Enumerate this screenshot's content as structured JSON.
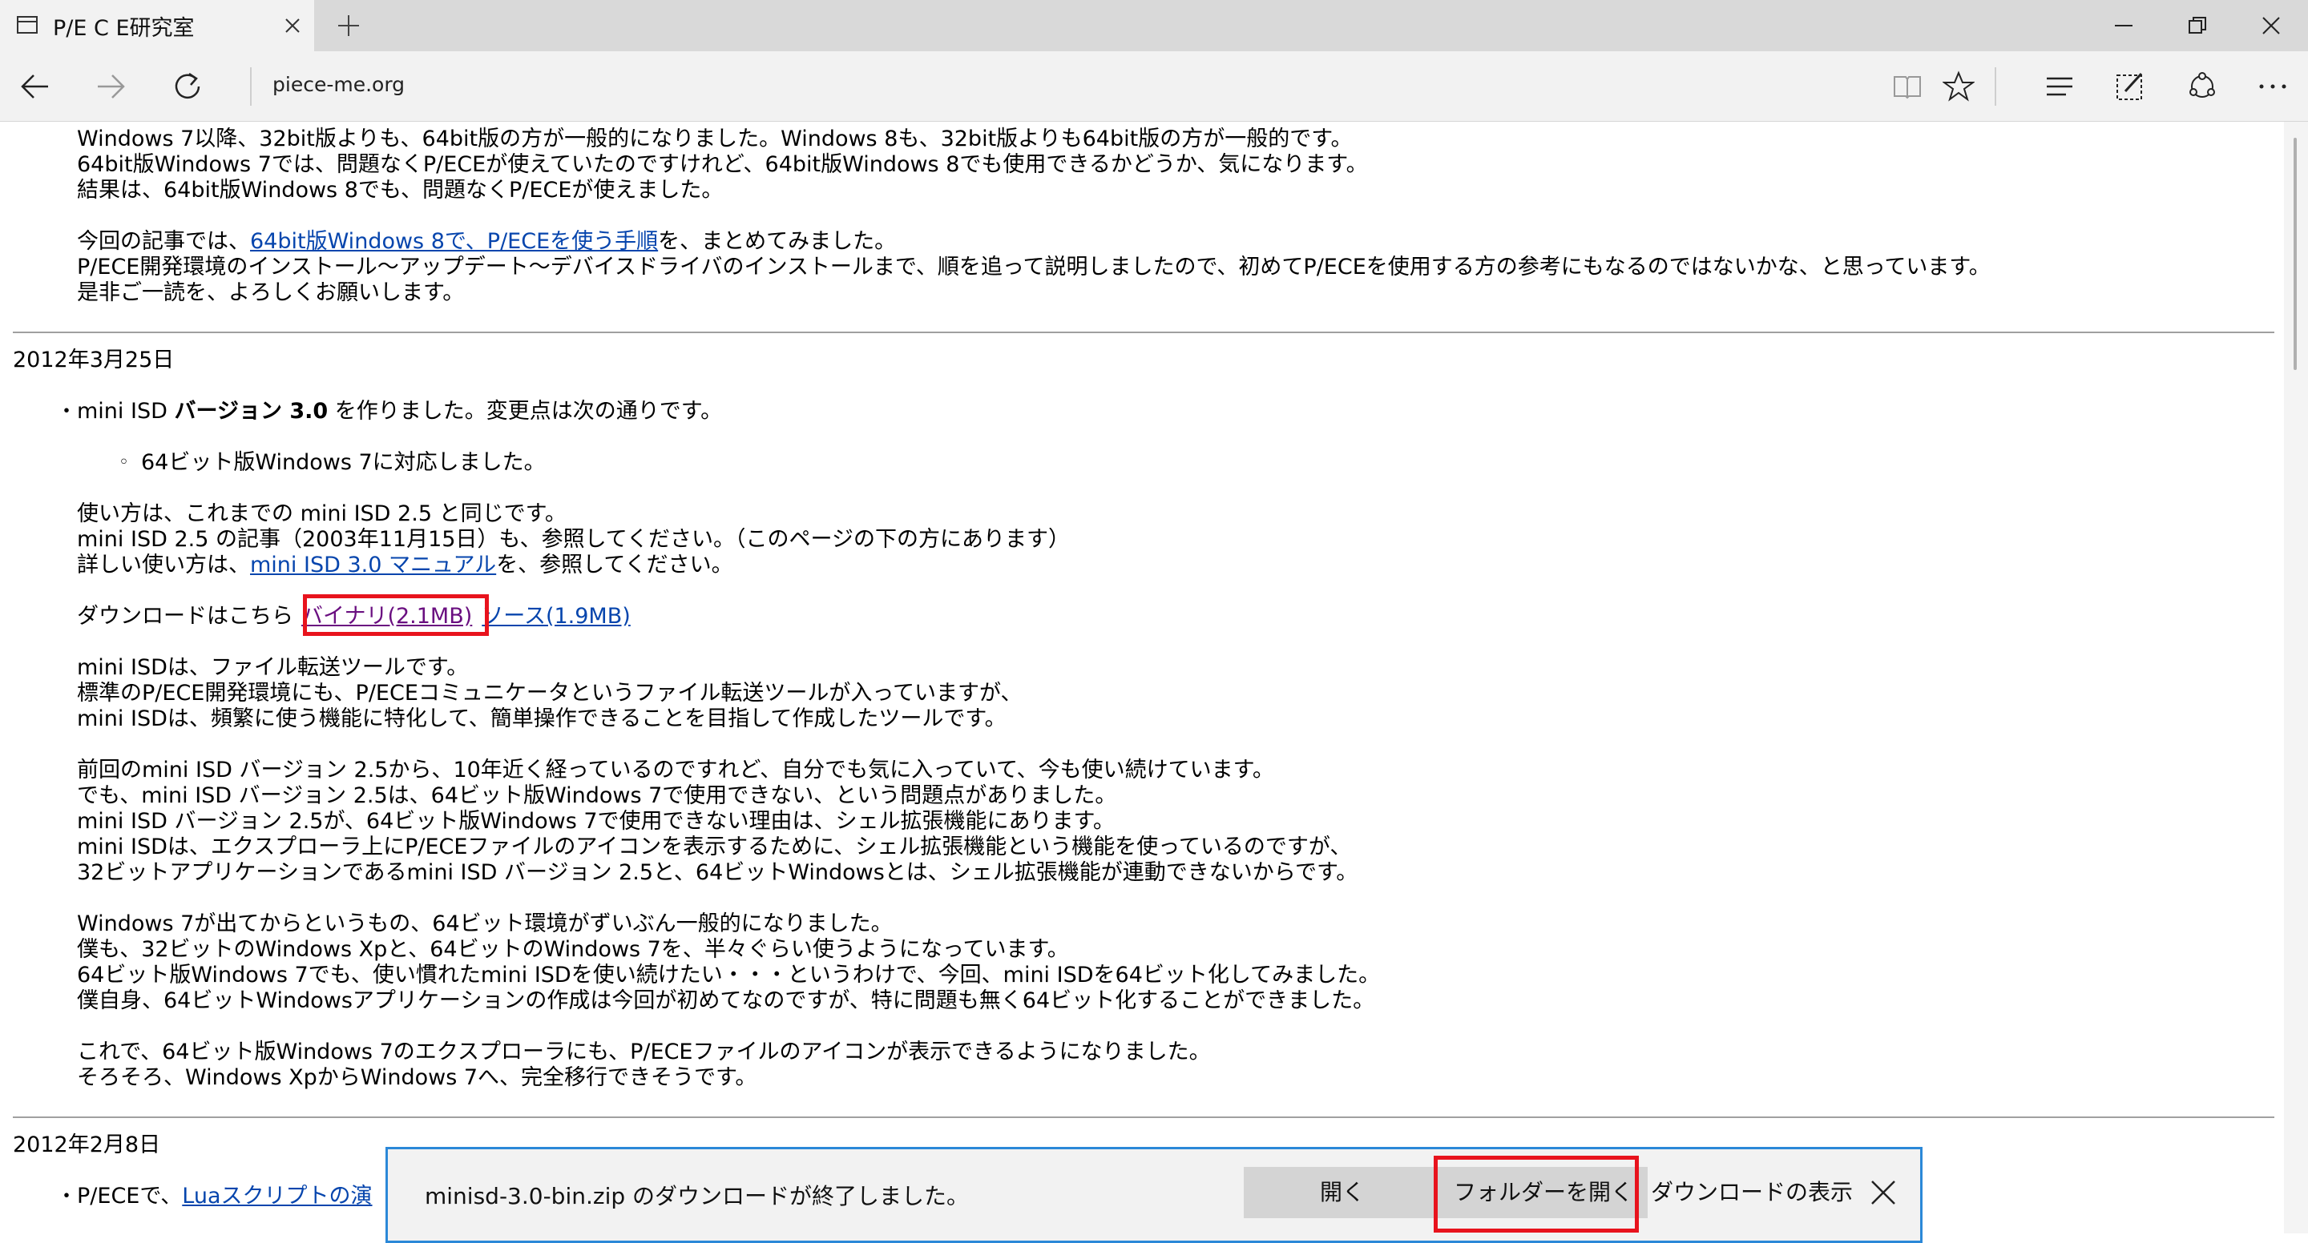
{
  "browser": {
    "tab_title": "P/E C E研究室",
    "new_tab_symbol": "+",
    "address": "piece-me.org",
    "icons": [
      "page-icon",
      "close-icon",
      "plus-icon",
      "minimize-icon",
      "restore-icon",
      "window-close-icon",
      "back-arrow-icon",
      "forward-arrow-icon",
      "refresh-icon",
      "reading-view-icon",
      "favorite-star-icon",
      "hub-icon",
      "web-note-icon",
      "share-icon",
      "more-icon"
    ]
  },
  "content": {
    "top_lines": [
      "Windows 7以降、32bit版よりも、64bit版の方が一般的になりました。Windows 8も、32bit版よりも64bit版の方が一般的です。",
      "64bit版Windows 7では、問題なくP/ECEが使えていたのですけれど、64bit版Windows 8でも使用できるかどうか、気になります。",
      "結果は、64bit版Windows 8でも、問題なくP/ECEが使えました。"
    ],
    "article_prefix": "今回の記事では、",
    "article_link": "64bit版Windows 8で、P/ECEを使う手順",
    "article_suffix": "を、まとめてみました。",
    "article_lines": [
      "P/ECE開発環境のインストール～アップデート～デバイスドライバのインストールまで、順を追って説明しましたので、初めてP/ECEを使用する方の参考にもなるのではないかな、と思っています。",
      "是非ご一読を、よろしくお願いします。"
    ],
    "date1": "2012年3月25日",
    "bullet": "・",
    "sub_bullet": "◦",
    "item_prefix": "mini ISD ",
    "item_bold": "バージョン 3.0",
    "item_suffix": " を作りました。変更点は次の通りです。",
    "sub_item": "64ビット版Windows 7に対応しました。",
    "usage_lines": [
      "使い方は、これまでの mini ISD 2.5 と同じです。",
      "mini ISD 2.5 の記事（2003年11月15日）も、参照してください。（このページの下の方にあります）"
    ],
    "manual_prefix": "詳しい使い方は、",
    "manual_link": "mini ISD 3.0 マニュアル",
    "manual_suffix": "を、参照してください。",
    "download_prefix": "ダウンロードはこちら",
    "binary_link": "バイナリ(2.1MB)",
    "source_link": "ソース(1.9MB)",
    "para1": [
      "mini ISDは、ファイル転送ツールです。",
      "標準のP/ECE開発環境にも、P/ECEコミュニケータというファイル転送ツールが入っていますが、",
      "mini ISDは、頻繁に使う機能に特化して、簡単操作できることを目指して作成したツールです。"
    ],
    "para2": [
      "前回のmini ISD バージョン 2.5から、10年近く経っているのですれど、自分でも気に入っていて、今も使い続けています。",
      "でも、mini ISD バージョン 2.5は、64ビット版Windows 7で使用できない、という問題点がありました。",
      "mini ISD バージョン 2.5が、64ビット版Windows 7で使用できない理由は、シェル拡張機能にあります。",
      "mini ISDは、エクスプローラ上にP/ECEファイルのアイコンを表示するために、シェル拡張機能という機能を使っているのですが、",
      "32ビットアプリケーションであるmini ISD バージョン 2.5と、64ビットWindowsとは、シェル拡張機能が連動できないからです。"
    ],
    "para3": [
      "Windows 7が出てからというもの、64ビット環境がずいぶん一般的になりました。",
      "僕も、32ビットのWindows Xpと、64ビットのWindows 7を、半々ぐらい使うようになっています。",
      "64ビット版Windows 7でも、使い慣れたmini ISDを使い続けたい・・・というわけで、今回、mini ISDを64ビット化してみました。",
      "僕自身、64ビットWindowsアプリケーションの作成は今回が初めてなのですが、特に問題も無く64ビット化することができました。"
    ],
    "para4": [
      "これで、64ビット版Windows 7のエクスプローラにも、P/ECEファイルのアイコンが表示できるようになりました。",
      "そろそろ、Windows XpからWindows 7へ、完全移行できそうです。"
    ],
    "date2": "2012年2月8日",
    "last_prefix": "P/ECEで、",
    "last_link": "Luaスクリプトの演"
  },
  "download_bar": {
    "message": "minisd-3.0-bin.zip のダウンロードが終了しました。",
    "open_label": "開く",
    "open_folder_label": "フォルダーを開く",
    "view_downloads_label": "ダウンロードの表示",
    "accent_color": "#2b88d8",
    "highlight_color": "#e8131d"
  }
}
